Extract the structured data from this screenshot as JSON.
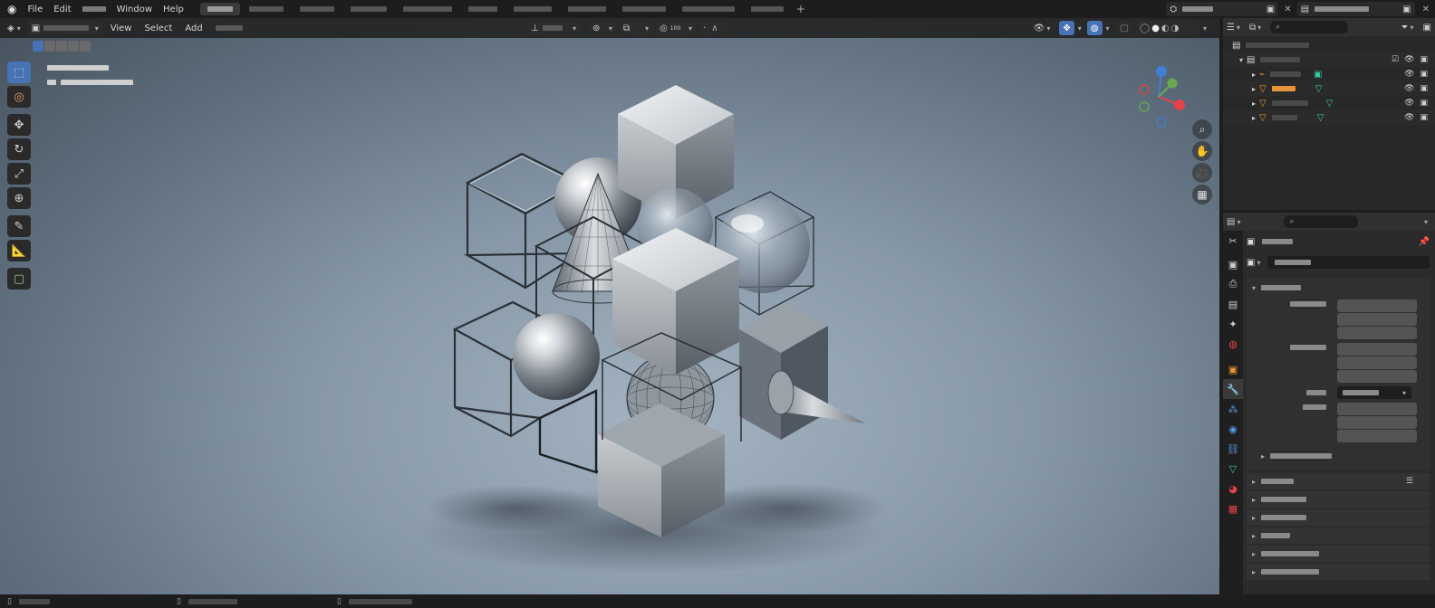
{
  "menu": {
    "file": "File",
    "edit": "Edit",
    "window": "Window",
    "help": "Help"
  },
  "viewport_menu": {
    "view": "View",
    "select": "Select",
    "add": "Add"
  },
  "proportional_size": "100",
  "icons": {
    "app": "blender-logo-icon",
    "select": "select-box-icon",
    "cursor": "cursor-icon",
    "move": "move-icon",
    "rotate": "rotate-icon",
    "scale": "scale-icon",
    "transform": "transform-icon",
    "annotate": "annotate-icon",
    "measure": "measure-icon",
    "add_cube": "add-cube-icon",
    "zoom": "zoom-icon",
    "pan": "hand-icon",
    "camera": "camera-icon",
    "grid": "grid-icon"
  },
  "colors": {
    "accent": "#4772b3",
    "selection": "#334d80",
    "axis_x": "#e5424b",
    "axis_y": "#6aa84f",
    "axis_z": "#3f7fd6",
    "mesh_icon": "#e8943a",
    "modifier_icon": "#37c7a6"
  },
  "outliner": {
    "rows": [
      {
        "indent": 0,
        "type": "scene",
        "selected": false
      },
      {
        "indent": 1,
        "type": "collection",
        "selected": false
      },
      {
        "indent": 2,
        "type": "camera",
        "selected": false
      },
      {
        "indent": 2,
        "type": "mesh",
        "selected": true
      },
      {
        "indent": 2,
        "type": "mesh",
        "selected": false
      },
      {
        "indent": 2,
        "type": "mesh",
        "selected": false
      }
    ]
  }
}
